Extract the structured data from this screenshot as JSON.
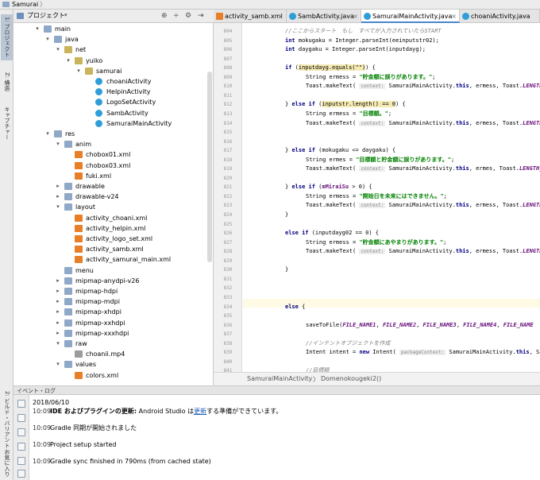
{
  "breadcrumb": {
    "project": "Samurai"
  },
  "left_strip": {
    "tabs": [
      "1: プロジェクト",
      "Z: 構造",
      "キャプチャー"
    ],
    "bottom_tabs": [
      "2: ビルド・バリアント",
      "お気に入り"
    ]
  },
  "project_panel": {
    "title": "プロジェクト",
    "tree": [
      {
        "depth": 4,
        "arrow": "open",
        "icon": "folder",
        "label": "main"
      },
      {
        "depth": 5,
        "arrow": "open",
        "icon": "folder",
        "label": "java"
      },
      {
        "depth": 6,
        "arrow": "open",
        "icon": "package",
        "label": "net"
      },
      {
        "depth": 7,
        "arrow": "open",
        "icon": "package",
        "label": "yuiko"
      },
      {
        "depth": 8,
        "arrow": "open",
        "icon": "package",
        "label": "samurai"
      },
      {
        "depth": 9,
        "arrow": "",
        "icon": "cls",
        "label": "choaniActivity"
      },
      {
        "depth": 9,
        "arrow": "",
        "icon": "cls",
        "label": "HelpinActivity"
      },
      {
        "depth": 9,
        "arrow": "",
        "icon": "cls",
        "label": "LogoSetActivity"
      },
      {
        "depth": 9,
        "arrow": "",
        "icon": "cls",
        "label": "SambActivity"
      },
      {
        "depth": 9,
        "arrow": "",
        "icon": "cls",
        "label": "SamuraiMainActivity"
      },
      {
        "depth": 5,
        "arrow": "open",
        "icon": "folder-res",
        "label": "res"
      },
      {
        "depth": 6,
        "arrow": "open",
        "icon": "folder",
        "label": "anim"
      },
      {
        "depth": 7,
        "arrow": "",
        "icon": "xml",
        "label": "chobox01.xml"
      },
      {
        "depth": 7,
        "arrow": "",
        "icon": "xml",
        "label": "chobox03.xml"
      },
      {
        "depth": 7,
        "arrow": "",
        "icon": "xml",
        "label": "fuki.xml"
      },
      {
        "depth": 6,
        "arrow": "closed",
        "icon": "folder",
        "label": "drawable"
      },
      {
        "depth": 6,
        "arrow": "closed",
        "icon": "folder",
        "label": "drawable-v24"
      },
      {
        "depth": 6,
        "arrow": "open",
        "icon": "folder",
        "label": "layout"
      },
      {
        "depth": 7,
        "arrow": "",
        "icon": "xml",
        "label": "activity_choani.xml"
      },
      {
        "depth": 7,
        "arrow": "",
        "icon": "xml",
        "label": "activity_helpin.xml"
      },
      {
        "depth": 7,
        "arrow": "",
        "icon": "xml",
        "label": "activity_logo_set.xml"
      },
      {
        "depth": 7,
        "arrow": "",
        "icon": "xml",
        "label": "activity_samb.xml"
      },
      {
        "depth": 7,
        "arrow": "",
        "icon": "xml",
        "label": "activity_samurai_main.xml"
      },
      {
        "depth": 6,
        "arrow": "",
        "icon": "folder",
        "label": "menu"
      },
      {
        "depth": 6,
        "arrow": "closed",
        "icon": "folder",
        "label": "mipmap-anydpi-v26"
      },
      {
        "depth": 6,
        "arrow": "closed",
        "icon": "folder",
        "label": "mipmap-hdpi"
      },
      {
        "depth": 6,
        "arrow": "closed",
        "icon": "folder",
        "label": "mipmap-mdpi"
      },
      {
        "depth": 6,
        "arrow": "closed",
        "icon": "folder",
        "label": "mipmap-xhdpi"
      },
      {
        "depth": 6,
        "arrow": "closed",
        "icon": "folder",
        "label": "mipmap-xxhdpi"
      },
      {
        "depth": 6,
        "arrow": "closed",
        "icon": "folder",
        "label": "mipmap-xxxhdpi"
      },
      {
        "depth": 6,
        "arrow": "open",
        "icon": "folder",
        "label": "raw"
      },
      {
        "depth": 7,
        "arrow": "",
        "icon": "media",
        "label": "choanii.mp4"
      },
      {
        "depth": 6,
        "arrow": "open",
        "icon": "folder",
        "label": "values"
      },
      {
        "depth": 7,
        "arrow": "",
        "icon": "xml",
        "label": "colors.xml"
      }
    ]
  },
  "tabs": [
    {
      "label": "activity_samb.xml",
      "icon": "xml",
      "active": false
    },
    {
      "label": "SambActivity.java",
      "icon": "cls",
      "active": false
    },
    {
      "label": "SamuraiMainActivity.java",
      "icon": "cls",
      "active": true
    },
    {
      "label": "choaniActivity.java",
      "icon": "cls",
      "active": false
    }
  ],
  "editor": {
    "line_numbers": [
      "804",
      "805",
      "806",
      "807",
      "808",
      "809",
      "810",
      "811",
      "812",
      "813",
      "814",
      "815",
      "816",
      "817",
      "818",
      "819",
      "820",
      "821",
      "822",
      "823",
      "824",
      "825",
      "826",
      "827",
      "828",
      "829",
      "830",
      "831",
      "832",
      "833",
      "834",
      "835",
      "836",
      "837",
      "838",
      "839",
      "840",
      "841"
    ],
    "highlighted_line": "834",
    "lines": [
      {
        "n": 0,
        "ind": 4,
        "parts": [
          [
            "cm",
            "//ここからスタート　もし　すべてが入力されていたらSTART"
          ]
        ]
      },
      {
        "n": 1,
        "ind": 4,
        "parts": [
          [
            "kw",
            "int "
          ],
          [
            "",
            "mokugaku = Integer.parseInt(eeinputstr02);"
          ]
        ]
      },
      {
        "n": 2,
        "ind": 4,
        "parts": [
          [
            "kw",
            "int "
          ],
          [
            "",
            "daygaku = Integer.parseInt(inputdayg);"
          ]
        ]
      },
      {
        "n": 4,
        "ind": 4,
        "parts": [
          [
            "kw",
            "if "
          ],
          [
            "",
            "("
          ],
          [
            "mark",
            "inputdayg.equals(\"\")"
          ],
          [
            "",
            ") {"
          ]
        ]
      },
      {
        "n": 5,
        "ind": 6,
        "parts": [
          [
            "",
            "String ermess = "
          ],
          [
            "str",
            "\"貯金額に誤りがあります。\""
          ],
          [
            "",
            ";"
          ]
        ]
      },
      {
        "n": 6,
        "ind": 6,
        "parts": [
          [
            "",
            "Toast.makeText( "
          ],
          [
            "hint",
            "context:"
          ],
          [
            "",
            " SamuraiMainActivity."
          ],
          [
            "kw",
            "this"
          ],
          [
            "",
            ", ermess, Toast."
          ],
          [
            "cst",
            "LENGTH_SHORT"
          ]
        ]
      },
      {
        "n": 8,
        "ind": 4,
        "parts": [
          [
            "",
            "} "
          ],
          [
            "kw",
            "else if "
          ],
          [
            "",
            "("
          ],
          [
            "mark",
            "inputstr.length() == 0"
          ],
          [
            "",
            ") {"
          ]
        ]
      },
      {
        "n": 9,
        "ind": 6,
        "parts": [
          [
            "",
            "String ermess = "
          ],
          [
            "str",
            "\"目標額。\""
          ],
          [
            "",
            ";"
          ]
        ]
      },
      {
        "n": 10,
        "ind": 6,
        "parts": [
          [
            "",
            "Toast.makeText( "
          ],
          [
            "hint",
            "context:"
          ],
          [
            "",
            " SamuraiMainActivity."
          ],
          [
            "kw",
            "this"
          ],
          [
            "",
            ", ermess, Toast."
          ],
          [
            "cst",
            "LENGTH_SHORT"
          ]
        ]
      },
      {
        "n": 13,
        "ind": 4,
        "parts": [
          [
            "",
            "} "
          ],
          [
            "kw",
            "else if "
          ],
          [
            "",
            "(mokugaku <= daygaku) {"
          ]
        ]
      },
      {
        "n": 14,
        "ind": 6,
        "parts": [
          [
            "",
            "String ermes = "
          ],
          [
            "str",
            "\"目標額と貯金額に誤りがあります。\""
          ],
          [
            "",
            ";"
          ]
        ]
      },
      {
        "n": 15,
        "ind": 6,
        "parts": [
          [
            "",
            "Toast.makeText( "
          ],
          [
            "hint",
            "context:"
          ],
          [
            "",
            " SamuraiMainActivity."
          ],
          [
            "kw",
            "this"
          ],
          [
            "",
            ", ermes, Toast."
          ],
          [
            "cst",
            "LENGTH_SHORT"
          ]
        ]
      },
      {
        "n": 17,
        "ind": 4,
        "parts": [
          [
            "",
            "} "
          ],
          [
            "kw",
            "else if "
          ],
          [
            "",
            "("
          ],
          [
            "fld",
            "mMiraiSu"
          ],
          [
            "",
            " > 0) {"
          ]
        ]
      },
      {
        "n": 18,
        "ind": 6,
        "parts": [
          [
            "",
            "String ermess = "
          ],
          [
            "str",
            "\"開始日を未来にはできません。\""
          ],
          [
            "",
            ";"
          ]
        ]
      },
      {
        "n": 19,
        "ind": 6,
        "parts": [
          [
            "",
            "Toast.makeText( "
          ],
          [
            "hint",
            "context:"
          ],
          [
            "",
            " SamuraiMainActivity."
          ],
          [
            "kw",
            "this"
          ],
          [
            "",
            ", ermess, Toast."
          ],
          [
            "cst",
            "LENGTH_SHORT"
          ]
        ]
      },
      {
        "n": 20,
        "ind": 4,
        "parts": [
          [
            "",
            "}"
          ]
        ]
      },
      {
        "n": 22,
        "ind": 4,
        "parts": [
          [
            "kw",
            "else if "
          ],
          [
            "",
            "(inputdayg02 == 0) {"
          ]
        ]
      },
      {
        "n": 23,
        "ind": 6,
        "parts": [
          [
            "",
            "String ermess = "
          ],
          [
            "str",
            "\"貯金額にあやまりがあります。\""
          ],
          [
            "",
            ";"
          ]
        ]
      },
      {
        "n": 24,
        "ind": 6,
        "parts": [
          [
            "",
            "Toast.makeText( "
          ],
          [
            "hint",
            "context:"
          ],
          [
            "",
            " SamuraiMainActivity."
          ],
          [
            "kw",
            "this"
          ],
          [
            "",
            ", ermess, Toast."
          ],
          [
            "cst",
            "LENGTH_SHORT"
          ]
        ]
      },
      {
        "n": 26,
        "ind": 4,
        "parts": [
          [
            "",
            "}"
          ]
        ]
      },
      {
        "n": 30,
        "ind": 4,
        "parts": [
          [
            "kw",
            "else "
          ],
          [
            "",
            "{"
          ]
        ]
      },
      {
        "n": 32,
        "ind": 6,
        "parts": [
          [
            "",
            "saveToFile("
          ],
          [
            "cst",
            "FILE_NAME1"
          ],
          [
            "",
            ", "
          ],
          [
            "cst",
            "FILE_NAME2"
          ],
          [
            "",
            ", "
          ],
          [
            "cst",
            "FILE_NAME3"
          ],
          [
            "",
            ", "
          ],
          [
            "cst",
            "FILE_NAME4"
          ],
          [
            "",
            ", "
          ],
          [
            "cst",
            "FILE_NAME"
          ]
        ]
      },
      {
        "n": 34,
        "ind": 6,
        "parts": [
          [
            "cm",
            "//インテントオブジェクトを作成"
          ]
        ]
      },
      {
        "n": 35,
        "ind": 6,
        "parts": [
          [
            "",
            "Intent intent = "
          ],
          [
            "kw",
            "new "
          ],
          [
            "",
            "Intent( "
          ],
          [
            "hint",
            "packageContext:"
          ],
          [
            "",
            " SamuraiMainActivity."
          ],
          [
            "kw",
            "this"
          ],
          [
            "",
            ", SambAct"
          ]
        ]
      },
      {
        "n": 37,
        "ind": 6,
        "parts": [
          [
            "cm",
            "//目標額"
          ]
        ]
      }
    ],
    "crumb": [
      "SamuraiMainActivity",
      "Domenokougeki2()"
    ]
  },
  "event_log": {
    "title": "イベント・ログ",
    "date": "2018/06/10",
    "entries": [
      {
        "time": "10:09",
        "bold": "IDE およびプラグインの更新:",
        "text_before": " Android Studio は",
        "link": "更新",
        "text_after": "する準備ができています。"
      },
      {
        "time": "10:09",
        "bold": "",
        "text_before": "Gradle 同期が開始されました",
        "link": "",
        "text_after": ""
      },
      {
        "time": "10:09",
        "bold": "",
        "text_before": "Project setup started",
        "link": "",
        "text_after": ""
      },
      {
        "time": "10:09",
        "bold": "",
        "text_before": "Gradle sync finished in 790ms (from cached state)",
        "link": "",
        "text_after": ""
      }
    ]
  }
}
